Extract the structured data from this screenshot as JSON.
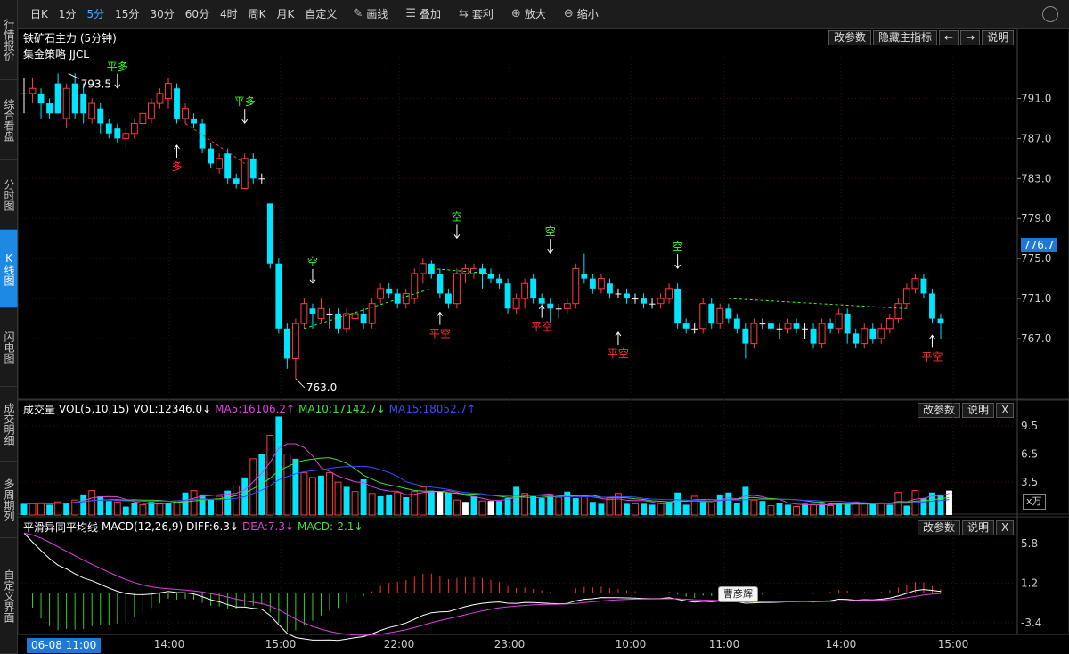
{
  "sidebar": {
    "tabs": [
      {
        "label": "行情报价",
        "active": false
      },
      {
        "label": "综合看盘",
        "active": false
      },
      {
        "label": "分时图",
        "active": false
      },
      {
        "label": "K线图",
        "active": true
      },
      {
        "label": "闪电图",
        "active": false
      },
      {
        "label": "成交明细",
        "active": false
      },
      {
        "label": "多周期列",
        "active": false
      },
      {
        "label": "自定义界面",
        "active": false
      }
    ]
  },
  "toolbar": {
    "periods": [
      "日K",
      "1分",
      "5分",
      "15分",
      "30分",
      "60分",
      "4时",
      "周K",
      "月K",
      "自定义"
    ],
    "active_period": "5分",
    "tools": [
      {
        "label": "画线",
        "icon": "pencil-icon"
      },
      {
        "label": "叠加",
        "icon": "stack-icon"
      },
      {
        "label": "套利",
        "icon": "arbitrage-icon"
      },
      {
        "label": "放大",
        "icon": "zoom-in-icon"
      },
      {
        "label": "缩小",
        "icon": "zoom-out-icon"
      }
    ]
  },
  "main_pane": {
    "title": "铁矿石主力 (5分钟)",
    "strategy": "集金策略 JJCL",
    "buttons": [
      "改参数",
      "隐藏主指标",
      "←",
      "→",
      "说明"
    ],
    "current_price": "776.7",
    "price_axis": [
      "791.0",
      "787.0",
      "783.0",
      "779.0",
      "775.0",
      "771.0",
      "767.0"
    ],
    "high_label": "793.5",
    "low_label": "763.0"
  },
  "volume_pane": {
    "name": "成交量",
    "indicator": "VOL(5,10,15)",
    "vol": "VOL:12346.0↓",
    "ma5": "MA5:16106.2↑",
    "ma10": "MA10:17142.7↓",
    "ma15": "MA15:18052.7↑",
    "buttons": [
      "改参数",
      "说明",
      "X"
    ],
    "axis": [
      "9.5",
      "6.5",
      "3.5"
    ],
    "unit": "x万"
  },
  "macd_pane": {
    "name": "平滑异同平均线",
    "indicator": "MACD(12,26,9)",
    "diff": "DIFF:6.3↓",
    "dea": "DEA:7.3↓",
    "macd": "MACD:-2.1↓",
    "buttons": [
      "改参数",
      "说明",
      "X"
    ],
    "axis": [
      "5.8",
      "1.2",
      "-3.4"
    ]
  },
  "time_axis": {
    "current_date": "06-08 11:00",
    "labels": [
      "14:00",
      "15:00",
      "22:00",
      "23:00",
      "10:00",
      "11:00",
      "14:00",
      "15:00"
    ]
  },
  "tooltip": "曹彦辉",
  "signals": [
    {
      "text": "平多",
      "kind": "close-long"
    },
    {
      "text": "多",
      "kind": "long"
    },
    {
      "text": "平多",
      "kind": "close-long"
    },
    {
      "text": "空",
      "kind": "short"
    },
    {
      "text": "平空",
      "kind": "close-short"
    },
    {
      "text": "空",
      "kind": "short"
    },
    {
      "text": "平空",
      "kind": "close-short"
    },
    {
      "text": "空",
      "kind": "short"
    },
    {
      "text": "平空",
      "kind": "close-short"
    },
    {
      "text": "空",
      "kind": "short"
    },
    {
      "text": "平空",
      "kind": "close-short"
    }
  ],
  "chart_data": {
    "type": "candlestick",
    "title": "铁矿石主力 (5分钟)",
    "candles": [
      [
        791.5,
        791.5,
        793.0,
        789.5
      ],
      [
        791.5,
        792.0,
        793.0,
        790.5
      ],
      [
        791.5,
        790.5,
        792.0,
        789.0
      ],
      [
        790.5,
        789.5,
        791.0,
        789.0
      ],
      [
        792.5,
        789.5,
        793.5,
        789.5
      ],
      [
        789.0,
        792.0,
        792.5,
        788.0
      ],
      [
        792.5,
        789.5,
        793.5,
        789.0
      ],
      [
        791.5,
        789.5,
        792.5,
        788.5
      ],
      [
        789.0,
        790.5,
        791.0,
        788.5
      ],
      [
        790.0,
        788.5,
        790.5,
        787.5
      ],
      [
        788.5,
        787.5,
        789.0,
        787.0
      ],
      [
        788.0,
        787.0,
        788.5,
        786.5
      ],
      [
        787.0,
        787.5,
        788.0,
        786.0
      ],
      [
        787.5,
        788.5,
        789.0,
        787.0
      ],
      [
        788.5,
        789.5,
        790.0,
        788.0
      ],
      [
        789.0,
        790.5,
        791.0,
        788.5
      ],
      [
        790.5,
        791.5,
        792.0,
        790.0
      ],
      [
        791.0,
        792.5,
        793.0,
        790.0
      ],
      [
        792.0,
        789.0,
        792.5,
        788.5
      ],
      [
        789.0,
        790.0,
        790.5,
        788.5
      ],
      [
        789.0,
        788.5,
        789.5,
        788.0
      ],
      [
        788.5,
        786.0,
        789.0,
        785.5
      ],
      [
        786.0,
        784.5,
        786.5,
        784.0
      ],
      [
        784.0,
        785.0,
        785.5,
        783.5
      ],
      [
        785.5,
        783.0,
        786.0,
        782.5
      ],
      [
        783.0,
        782.5,
        783.5,
        782.0
      ],
      [
        782.0,
        785.0,
        785.5,
        782.0
      ],
      [
        785.0,
        783.0,
        785.5,
        782.5
      ],
      [
        783.0,
        783.0,
        783.5,
        782.5
      ],
      [
        780.5,
        774.5,
        780.5,
        774.0
      ],
      [
        774.5,
        768.0,
        775.0,
        767.5
      ],
      [
        768.0,
        765.0,
        768.5,
        764.0
      ],
      [
        765.0,
        768.5,
        769.0,
        763.0
      ],
      [
        768.5,
        770.5,
        771.0,
        768.0
      ],
      [
        770.0,
        769.5,
        770.5,
        768.0
      ],
      [
        769.0,
        770.0,
        771.0,
        768.5
      ],
      [
        769.5,
        769.5,
        770.0,
        768.0
      ],
      [
        769.5,
        768.0,
        770.0,
        767.5
      ],
      [
        768.0,
        769.5,
        770.0,
        767.5
      ],
      [
        769.0,
        769.5,
        770.0,
        768.5
      ],
      [
        769.5,
        768.5,
        770.0,
        768.0
      ],
      [
        768.5,
        770.5,
        771.0,
        768.0
      ],
      [
        771.0,
        772.0,
        772.5,
        770.5
      ],
      [
        772.0,
        771.5,
        772.5,
        771.0
      ],
      [
        771.5,
        770.5,
        772.0,
        770.0
      ],
      [
        770.5,
        771.5,
        772.0,
        770.0
      ],
      [
        771.0,
        773.5,
        774.0,
        770.5
      ],
      [
        773.5,
        774.5,
        775.0,
        772.5
      ],
      [
        774.5,
        773.5,
        774.8,
        773.0
      ],
      [
        773.5,
        771.5,
        774.0,
        771.0
      ],
      [
        771.5,
        770.5,
        772.0,
        770.0
      ],
      [
        770.5,
        773.5,
        774.0,
        770.0
      ],
      [
        773.5,
        774.0,
        774.5,
        772.5
      ],
      [
        773.5,
        774.0,
        774.5,
        773.0
      ],
      [
        774.0,
        773.5,
        774.5,
        772.0
      ],
      [
        773.5,
        773.0,
        774.0,
        772.5
      ],
      [
        773.0,
        772.5,
        773.5,
        772.0
      ],
      [
        772.5,
        770.0,
        773.0,
        769.5
      ],
      [
        770.0,
        771.0,
        771.5,
        769.5
      ],
      [
        771.0,
        772.5,
        773.0,
        770.0
      ],
      [
        773.0,
        771.0,
        773.5,
        770.5
      ],
      [
        771.0,
        770.5,
        771.5,
        770.0
      ],
      [
        770.5,
        770.0,
        771.0,
        768.5
      ],
      [
        770.0,
        770.0,
        770.5,
        769.0
      ],
      [
        770.0,
        770.5,
        771.0,
        769.5
      ],
      [
        770.5,
        774.0,
        774.5,
        770.0
      ],
      [
        773.5,
        773.0,
        775.5,
        772.5
      ],
      [
        773.0,
        772.0,
        773.5,
        771.5
      ],
      [
        772.0,
        773.0,
        773.5,
        771.5
      ],
      [
        772.5,
        771.5,
        773.0,
        771.0
      ],
      [
        771.5,
        771.5,
        772.0,
        771.0
      ],
      [
        771.5,
        771.0,
        772.0,
        770.5
      ],
      [
        771.0,
        771.0,
        771.5,
        770.5
      ],
      [
        771.0,
        770.5,
        771.5,
        770.0
      ],
      [
        770.5,
        770.5,
        771.0,
        770.0
      ],
      [
        770.5,
        771.0,
        771.5,
        770.0
      ],
      [
        771.0,
        772.0,
        772.5,
        770.5
      ],
      [
        772.0,
        768.5,
        772.5,
        768.0
      ],
      [
        768.5,
        768.0,
        769.0,
        767.5
      ],
      [
        768.0,
        768.0,
        768.5,
        767.5
      ],
      [
        768.0,
        770.5,
        771.0,
        767.5
      ],
      [
        770.5,
        768.5,
        771.0,
        768.0
      ],
      [
        768.5,
        770.0,
        770.5,
        768.0
      ],
      [
        770.0,
        769.0,
        770.5,
        768.5
      ],
      [
        769.0,
        768.0,
        769.5,
        767.5
      ],
      [
        768.0,
        766.5,
        768.5,
        765.0
      ],
      [
        766.5,
        768.5,
        769.0,
        766.0
      ],
      [
        768.5,
        768.5,
        769.0,
        768.0
      ],
      [
        768.5,
        768.0,
        769.0,
        767.5
      ],
      [
        768.0,
        768.0,
        768.5,
        767.0
      ],
      [
        768.0,
        768.5,
        769.0,
        767.5
      ],
      [
        768.5,
        768.0,
        769.0,
        767.5
      ],
      [
        768.0,
        768.0,
        768.5,
        767.0
      ],
      [
        768.0,
        766.5,
        768.5,
        766.0
      ],
      [
        766.5,
        768.5,
        769.0,
        766.0
      ],
      [
        768.5,
        768.0,
        769.0,
        767.5
      ],
      [
        768.0,
        769.5,
        770.0,
        767.5
      ],
      [
        769.5,
        767.5,
        770.0,
        766.5
      ],
      [
        767.5,
        766.5,
        768.0,
        766.0
      ],
      [
        766.5,
        768.0,
        768.5,
        766.0
      ],
      [
        768.0,
        767.0,
        768.5,
        766.5
      ],
      [
        767.0,
        768.0,
        768.5,
        766.5
      ],
      [
        768.0,
        769.0,
        769.5,
        767.5
      ],
      [
        769.0,
        770.5,
        771.0,
        768.5
      ],
      [
        770.5,
        772.0,
        772.5,
        770.0
      ],
      [
        772.0,
        773.0,
        773.5,
        771.5
      ],
      [
        773.0,
        771.5,
        773.5,
        771.0
      ],
      [
        771.5,
        769.0,
        772.0,
        768.5
      ],
      [
        769.0,
        768.5,
        769.5,
        767.0
      ]
    ],
    "volume": [
      [
        1.2,
        0
      ],
      [
        1.2,
        1
      ],
      [
        1.3,
        1
      ],
      [
        1.1,
        0
      ],
      [
        1.4,
        1
      ],
      [
        1.3,
        0
      ],
      [
        1.6,
        1
      ],
      [
        2.2,
        0
      ],
      [
        2.6,
        1
      ],
      [
        2.0,
        0
      ],
      [
        1.5,
        0
      ],
      [
        1.4,
        1
      ],
      [
        0.9,
        0
      ],
      [
        1.3,
        0
      ],
      [
        1.1,
        1
      ],
      [
        1.4,
        0
      ],
      [
        1.2,
        1
      ],
      [
        1.3,
        0
      ],
      [
        1.5,
        1
      ],
      [
        2.4,
        0
      ],
      [
        2.6,
        1
      ],
      [
        2.2,
        0
      ],
      [
        1.7,
        0
      ],
      [
        2.0,
        1
      ],
      [
        2.6,
        0
      ],
      [
        3.1,
        1
      ],
      [
        4.0,
        0
      ],
      [
        6.0,
        1
      ],
      [
        6.5,
        0
      ],
      [
        8.5,
        1
      ],
      [
        10.5,
        0
      ],
      [
        6.5,
        1
      ],
      [
        6.0,
        0
      ],
      [
        4.5,
        1
      ],
      [
        4.0,
        1
      ],
      [
        4.2,
        0
      ],
      [
        4.5,
        1
      ],
      [
        3.5,
        1
      ],
      [
        3.0,
        0
      ],
      [
        2.5,
        1
      ],
      [
        3.8,
        0
      ],
      [
        2.3,
        1
      ],
      [
        2.0,
        0
      ],
      [
        2.2,
        0
      ],
      [
        2.4,
        1
      ],
      [
        1.9,
        0
      ],
      [
        2.5,
        1
      ],
      [
        3.0,
        1
      ],
      [
        2.6,
        0
      ],
      [
        2.5,
        2
      ],
      [
        2.4,
        0
      ],
      [
        1.6,
        1
      ],
      [
        1.4,
        2
      ],
      [
        2.0,
        0
      ],
      [
        1.5,
        1
      ],
      [
        1.5,
        2
      ],
      [
        1.5,
        0
      ],
      [
        1.8,
        0
      ],
      [
        3.0,
        0
      ],
      [
        2.3,
        1
      ],
      [
        2.0,
        0
      ],
      [
        1.8,
        0
      ],
      [
        2.2,
        0
      ],
      [
        1.9,
        1
      ],
      [
        2.5,
        0
      ],
      [
        1.8,
        0
      ],
      [
        2.0,
        1
      ],
      [
        1.4,
        0
      ],
      [
        1.2,
        0
      ],
      [
        1.8,
        1
      ],
      [
        2.3,
        1
      ],
      [
        1.2,
        0
      ],
      [
        1.2,
        1
      ],
      [
        1.2,
        0
      ],
      [
        1.1,
        0
      ],
      [
        1.3,
        1
      ],
      [
        1.4,
        0
      ],
      [
        2.4,
        0
      ],
      [
        1.1,
        0
      ],
      [
        2.0,
        1
      ],
      [
        1.4,
        0
      ],
      [
        1.3,
        1
      ],
      [
        2.2,
        0
      ],
      [
        2.4,
        0
      ],
      [
        1.3,
        0
      ],
      [
        3.0,
        0
      ],
      [
        1.6,
        1
      ],
      [
        1.5,
        0
      ],
      [
        1.0,
        1
      ],
      [
        1.3,
        0
      ],
      [
        1.1,
        0
      ],
      [
        0.9,
        1
      ],
      [
        1.2,
        0
      ],
      [
        1.1,
        1
      ],
      [
        1.2,
        0
      ],
      [
        1.0,
        1
      ],
      [
        1.3,
        0
      ],
      [
        1.2,
        0
      ],
      [
        1.4,
        1
      ],
      [
        1.2,
        1
      ],
      [
        1.3,
        0
      ],
      [
        1.3,
        1
      ],
      [
        1.1,
        0
      ],
      [
        2.4,
        1
      ],
      [
        1.0,
        0
      ],
      [
        2.6,
        1
      ],
      [
        1.8,
        0
      ],
      [
        2.4,
        0
      ],
      [
        2.2,
        0
      ],
      [
        2.6,
        2
      ]
    ],
    "xlabel": "",
    "ylabel": ""
  }
}
